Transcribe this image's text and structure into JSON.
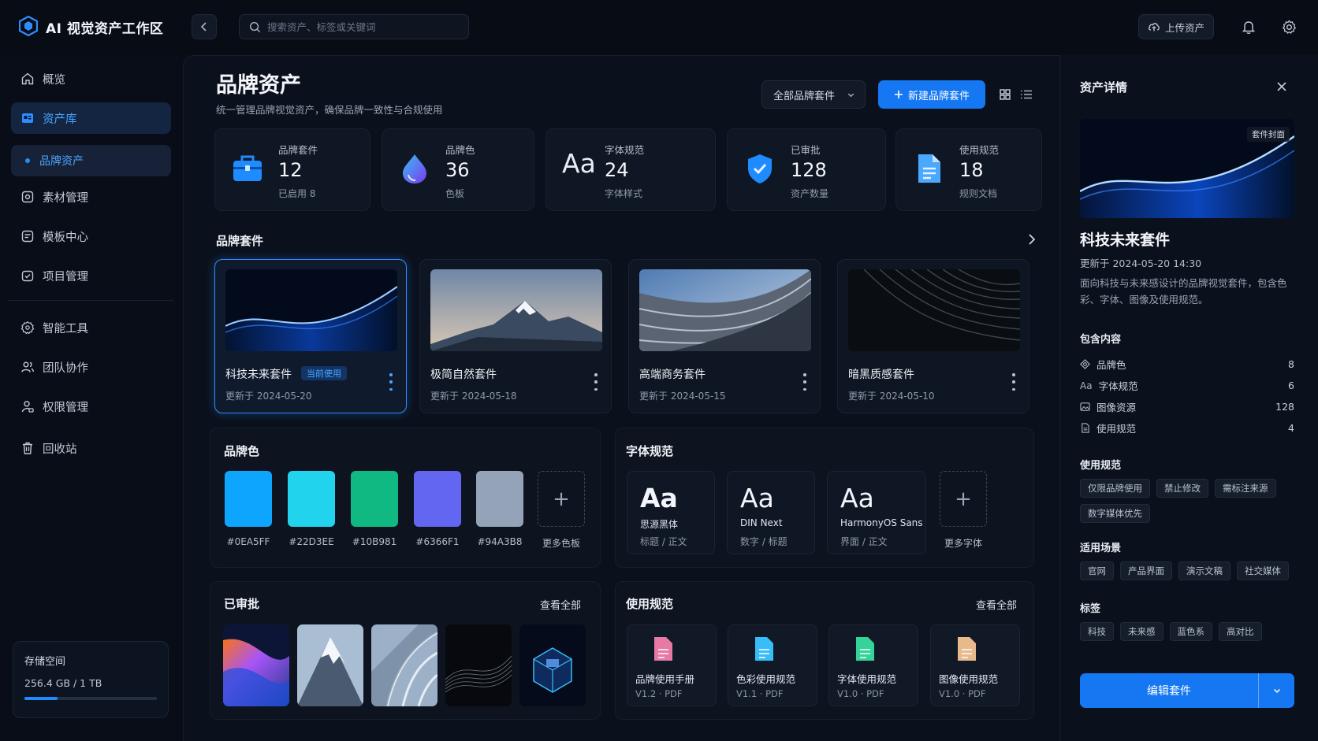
{
  "app": {
    "title": "AI 视觉资产工作区"
  },
  "search": {
    "placeholder": "搜索资产、标签或关键词"
  },
  "topbar": {
    "upload_label": "上传资产"
  },
  "sidebar": {
    "items": [
      {
        "label": "概览",
        "icon": "home-icon"
      },
      {
        "label": "资产库",
        "icon": "library-icon",
        "active": true
      },
      {
        "label": "品牌资产",
        "sub": true
      },
      {
        "label": "素材管理",
        "icon": "image-icon"
      },
      {
        "label": "模板中心",
        "icon": "template-icon"
      },
      {
        "label": "项目管理",
        "icon": "project-icon"
      },
      {
        "label": "智能工具",
        "icon": "ai-tool-icon"
      },
      {
        "label": "团队协作",
        "icon": "team-icon"
      },
      {
        "label": "权限管理",
        "icon": "permission-icon"
      },
      {
        "label": "回收站",
        "icon": "trash-icon"
      }
    ],
    "storage": {
      "title": "存储空间",
      "value": "256.4 GB / 1 TB",
      "fraction": 0.25
    }
  },
  "page": {
    "title": "品牌资产",
    "subtitle": "统一管理品牌视觉资产，确保品牌一致性与合规使用",
    "filter_label": "全部品牌套件",
    "new_button": "新建品牌套件"
  },
  "stats": [
    {
      "label": "品牌套件",
      "value": "12",
      "sub": "已启用 8"
    },
    {
      "label": "品牌色",
      "value": "36",
      "sub": "色板"
    },
    {
      "label": "字体规范",
      "value": "24",
      "sub": "字体样式"
    },
    {
      "label": "已审批",
      "value": "128",
      "sub": "资产数量"
    },
    {
      "label": "使用规范",
      "value": "18",
      "sub": "规则文档"
    }
  ],
  "kits": {
    "title": "品牌套件",
    "items": [
      {
        "name": "科技未来套件",
        "date": "更新于 2024-05-20",
        "badge": "当前使用"
      },
      {
        "name": "极简自然套件",
        "date": "更新于 2024-05-18"
      },
      {
        "name": "高端商务套件",
        "date": "更新于 2024-05-15"
      },
      {
        "name": "暗黑质感套件",
        "date": "更新于 2024-05-10"
      }
    ]
  },
  "colors": {
    "title": "品牌色",
    "swatches": [
      {
        "hex": "#0EA5FF"
      },
      {
        "hex": "#22D3EE"
      },
      {
        "hex": "#10B981"
      },
      {
        "hex": "#6366F1"
      },
      {
        "hex": "#94A3B8"
      }
    ],
    "more_label": "更多色板"
  },
  "fonts": {
    "title": "字体规范",
    "items": [
      {
        "sample": "Aa",
        "name": "思源黑体",
        "usage": "标题 / 正文"
      },
      {
        "sample": "Aa",
        "name": "DIN Next",
        "usage": "数字 / 标题"
      },
      {
        "sample": "Aa",
        "name": "HarmonyOS Sans",
        "usage": "界面 / 正文"
      }
    ],
    "more_label": "更多字体"
  },
  "approved": {
    "title": "已审批",
    "view_all": "查看全部"
  },
  "guidelines": {
    "title": "使用规范",
    "view_all": "查看全部",
    "docs": [
      {
        "name": "品牌使用手册",
        "meta": "V1.2 · PDF",
        "color": "#e879a6"
      },
      {
        "name": "色彩使用规范",
        "meta": "V1.1 · PDF",
        "color": "#38bdf8"
      },
      {
        "name": "字体使用规范",
        "meta": "V1.0 · PDF",
        "color": "#34d399"
      },
      {
        "name": "图像使用规范",
        "meta": "V1.0 · PDF",
        "color": "#e8b98a"
      }
    ]
  },
  "detail": {
    "title": "资产详情",
    "cover_tag": "套件封面",
    "name": "科技未来套件",
    "updated": "更新于 2024-05-20 14:30",
    "description": "面向科技与未来感设计的品牌视觉套件，包含色彩、字体、图像及使用规范。",
    "contents_title": "包含内容",
    "contents": [
      {
        "label": "品牌色",
        "count": "8"
      },
      {
        "label": "字体规范",
        "count": "6"
      },
      {
        "label": "图像资源",
        "count": "128"
      },
      {
        "label": "使用规范",
        "count": "4"
      }
    ],
    "usage_title": "使用规范",
    "usage_tags": [
      "仅限品牌使用",
      "禁止修改",
      "需标注来源",
      "数字媒体优先"
    ],
    "scenes_title": "适用场景",
    "scene_tags": [
      "官网",
      "产品界面",
      "演示文稿",
      "社交媒体"
    ],
    "tags_title": "标签",
    "tags": [
      "科技",
      "未来感",
      "蓝色系",
      "高对比"
    ],
    "edit_button": "编辑套件"
  },
  "accent": "#1677F2"
}
